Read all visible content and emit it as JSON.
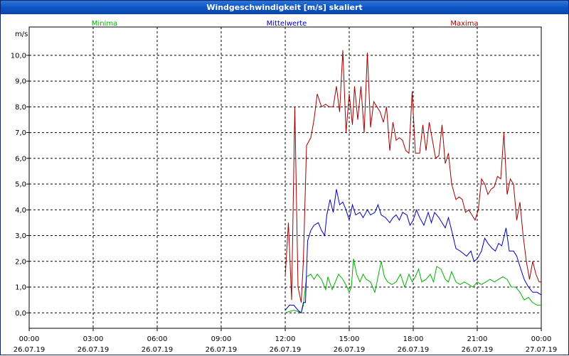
{
  "window": {
    "title": "Windgeschwindigkeit [m/s] skaliert"
  },
  "colors": {
    "minima": "#00b000",
    "mittelwerte": "#0000c0",
    "maxima": "#a00000",
    "grid": "#000000"
  },
  "chart_data": {
    "type": "line",
    "title": "Windgeschwindigkeit [m/s] skaliert",
    "ylabel": "m/s",
    "ylim": [
      -0.6,
      11.1
    ],
    "y_ticks": [
      "0,0",
      "1,0",
      "2,0",
      "3,0",
      "4,0",
      "5,0",
      "6,0",
      "7,0",
      "8,0",
      "9,0",
      "10,0"
    ],
    "xlim": [
      0,
      24
    ],
    "x_ticks": [
      {
        "time": "00:00",
        "date": "26.07.19"
      },
      {
        "time": "03:00",
        "date": "26.07.19"
      },
      {
        "time": "06:00",
        "date": "26.07.19"
      },
      {
        "time": "09:00",
        "date": "26.07.19"
      },
      {
        "time": "12:00",
        "date": "26.07.19"
      },
      {
        "time": "15:00",
        "date": "26.07.19"
      },
      {
        "time": "18:00",
        "date": "26.07.19"
      },
      {
        "time": "21:00",
        "date": "26.07.19"
      },
      {
        "time": "00:00",
        "date": "27.07.19"
      }
    ],
    "grid": true,
    "legend_position": "top",
    "series": [
      {
        "name": "Minima",
        "color": "#00b000",
        "points": [
          [
            12.0,
            0.0
          ],
          [
            12.2,
            0.05
          ],
          [
            12.4,
            0.1
          ],
          [
            12.6,
            0.05
          ],
          [
            12.75,
            0.0
          ],
          [
            12.85,
            0.3
          ],
          [
            13.0,
            1.4
          ],
          [
            13.2,
            1.5
          ],
          [
            13.35,
            1.3
          ],
          [
            13.5,
            1.5
          ],
          [
            13.7,
            1.3
          ],
          [
            13.9,
            0.9
          ],
          [
            14.0,
            1.4
          ],
          [
            14.2,
            0.9
          ],
          [
            14.4,
            1.3
          ],
          [
            14.5,
            1.5
          ],
          [
            14.7,
            1.3
          ],
          [
            14.9,
            1.0
          ],
          [
            15.0,
            0.8
          ],
          [
            15.1,
            1.0
          ],
          [
            15.2,
            2.1
          ],
          [
            15.35,
            1.5
          ],
          [
            15.5,
            1.2
          ],
          [
            15.65,
            1.5
          ],
          [
            15.8,
            1.3
          ],
          [
            16.0,
            1.2
          ],
          [
            16.2,
            0.8
          ],
          [
            16.35,
            1.4
          ],
          [
            16.5,
            2.0
          ],
          [
            16.65,
            1.4
          ],
          [
            16.8,
            1.2
          ],
          [
            17.0,
            1.1
          ],
          [
            17.2,
            1.2
          ],
          [
            17.4,
            1.5
          ],
          [
            17.6,
            1.0
          ],
          [
            17.8,
            1.5
          ],
          [
            17.95,
            1.2
          ],
          [
            18.1,
            1.4
          ],
          [
            18.25,
            1.7
          ],
          [
            18.4,
            1.2
          ],
          [
            18.6,
            1.3
          ],
          [
            18.8,
            1.5
          ],
          [
            18.95,
            1.2
          ],
          [
            19.1,
            1.8
          ],
          [
            19.3,
            1.7
          ],
          [
            19.5,
            1.3
          ],
          [
            19.65,
            1.2
          ],
          [
            19.8,
            1.6
          ],
          [
            20.0,
            1.2
          ],
          [
            20.2,
            1.1
          ],
          [
            20.4,
            1.2
          ],
          [
            20.6,
            1.1
          ],
          [
            20.8,
            1.0
          ],
          [
            21.0,
            1.2
          ],
          [
            21.2,
            1.1
          ],
          [
            21.4,
            1.2
          ],
          [
            21.6,
            1.3
          ],
          [
            21.8,
            1.2
          ],
          [
            22.0,
            1.3
          ],
          [
            22.2,
            1.4
          ],
          [
            22.4,
            1.3
          ],
          [
            22.6,
            1.0
          ],
          [
            22.8,
            1.0
          ],
          [
            23.0,
            0.8
          ],
          [
            23.2,
            0.5
          ],
          [
            23.4,
            0.6
          ],
          [
            23.6,
            0.4
          ],
          [
            23.8,
            0.3
          ],
          [
            24.0,
            0.3
          ]
        ]
      },
      {
        "name": "Mittelwerte",
        "color": "#0000c0",
        "points": [
          [
            12.0,
            0.1
          ],
          [
            12.2,
            0.3
          ],
          [
            12.4,
            0.3
          ],
          [
            12.6,
            0.1
          ],
          [
            12.75,
            0.0
          ],
          [
            12.85,
            0.4
          ],
          [
            12.95,
            0.4
          ],
          [
            13.05,
            2.8
          ],
          [
            13.2,
            3.2
          ],
          [
            13.35,
            3.4
          ],
          [
            13.55,
            3.5
          ],
          [
            13.7,
            3.2
          ],
          [
            13.85,
            3.0
          ],
          [
            13.95,
            3.8
          ],
          [
            14.1,
            4.4
          ],
          [
            14.25,
            3.9
          ],
          [
            14.4,
            4.8
          ],
          [
            14.55,
            4.2
          ],
          [
            14.7,
            4.3
          ],
          [
            14.85,
            4.0
          ],
          [
            15.0,
            3.6
          ],
          [
            15.15,
            4.2
          ],
          [
            15.3,
            3.8
          ],
          [
            15.5,
            3.9
          ],
          [
            15.65,
            3.7
          ],
          [
            15.85,
            4.0
          ],
          [
            16.0,
            3.8
          ],
          [
            16.2,
            3.9
          ],
          [
            16.35,
            4.2
          ],
          [
            16.5,
            3.8
          ],
          [
            16.7,
            3.7
          ],
          [
            16.9,
            3.5
          ],
          [
            17.05,
            3.7
          ],
          [
            17.2,
            3.8
          ],
          [
            17.35,
            3.6
          ],
          [
            17.5,
            3.9
          ],
          [
            17.7,
            3.8
          ],
          [
            17.85,
            3.4
          ],
          [
            18.0,
            3.6
          ],
          [
            18.15,
            4.0
          ],
          [
            18.3,
            3.7
          ],
          [
            18.5,
            3.4
          ],
          [
            18.7,
            3.9
          ],
          [
            18.85,
            3.5
          ],
          [
            19.0,
            3.9
          ],
          [
            19.2,
            3.7
          ],
          [
            19.35,
            3.5
          ],
          [
            19.5,
            3.3
          ],
          [
            19.65,
            3.7
          ],
          [
            19.8,
            3.2
          ],
          [
            20.0,
            2.5
          ],
          [
            20.2,
            2.4
          ],
          [
            20.35,
            2.3
          ],
          [
            20.5,
            2.2
          ],
          [
            20.7,
            2.4
          ],
          [
            20.85,
            2.0
          ],
          [
            21.0,
            2.1
          ],
          [
            21.2,
            2.4
          ],
          [
            21.35,
            2.9
          ],
          [
            21.5,
            2.7
          ],
          [
            21.7,
            2.5
          ],
          [
            21.85,
            2.4
          ],
          [
            22.0,
            2.7
          ],
          [
            22.15,
            2.6
          ],
          [
            22.35,
            3.3
          ],
          [
            22.5,
            2.4
          ],
          [
            22.7,
            2.4
          ],
          [
            22.85,
            2.2
          ],
          [
            23.0,
            1.8
          ],
          [
            23.2,
            1.3
          ],
          [
            23.4,
            1.0
          ],
          [
            23.6,
            0.8
          ],
          [
            23.8,
            0.8
          ],
          [
            24.0,
            0.7
          ]
        ]
      },
      {
        "name": "Maxima",
        "color": "#a00000",
        "points": [
          [
            12.0,
            1.4
          ],
          [
            12.15,
            3.5
          ],
          [
            12.3,
            0.5
          ],
          [
            12.45,
            8.0
          ],
          [
            12.6,
            1.0
          ],
          [
            12.75,
            0.4
          ],
          [
            12.85,
            2.0
          ],
          [
            13.0,
            6.5
          ],
          [
            13.2,
            6.8
          ],
          [
            13.35,
            7.5
          ],
          [
            13.5,
            8.5
          ],
          [
            13.7,
            8.0
          ],
          [
            13.9,
            8.1
          ],
          [
            14.05,
            8.0
          ],
          [
            14.25,
            8.0
          ],
          [
            14.4,
            8.8
          ],
          [
            14.55,
            7.8
          ],
          [
            14.7,
            10.2
          ],
          [
            14.85,
            7.0
          ],
          [
            15.0,
            8.5
          ],
          [
            15.15,
            7.3
          ],
          [
            15.25,
            8.8
          ],
          [
            15.4,
            7.5
          ],
          [
            15.55,
            8.8
          ],
          [
            15.7,
            7.0
          ],
          [
            15.85,
            10.1
          ],
          [
            16.0,
            7.2
          ],
          [
            16.15,
            8.2
          ],
          [
            16.3,
            8.0
          ],
          [
            16.45,
            7.8
          ],
          [
            16.6,
            7.4
          ],
          [
            16.75,
            8.0
          ],
          [
            16.9,
            6.3
          ],
          [
            17.05,
            7.4
          ],
          [
            17.2,
            6.7
          ],
          [
            17.35,
            6.8
          ],
          [
            17.5,
            6.7
          ],
          [
            17.65,
            6.3
          ],
          [
            17.8,
            6.2
          ],
          [
            17.95,
            8.6
          ],
          [
            18.1,
            6.2
          ],
          [
            18.3,
            6.2
          ],
          [
            18.45,
            7.3
          ],
          [
            18.6,
            6.3
          ],
          [
            18.75,
            7.4
          ],
          [
            18.9,
            6.7
          ],
          [
            19.05,
            6.0
          ],
          [
            19.2,
            6.1
          ],
          [
            19.35,
            7.3
          ],
          [
            19.5,
            5.8
          ],
          [
            19.65,
            6.2
          ],
          [
            19.8,
            5.0
          ],
          [
            20.0,
            4.4
          ],
          [
            20.15,
            4.5
          ],
          [
            20.3,
            4.4
          ],
          [
            20.45,
            3.9
          ],
          [
            20.6,
            4.0
          ],
          [
            20.75,
            3.8
          ],
          [
            20.9,
            3.6
          ],
          [
            21.05,
            4.0
          ],
          [
            21.2,
            5.2
          ],
          [
            21.35,
            5.0
          ],
          [
            21.5,
            4.6
          ],
          [
            21.65,
            4.8
          ],
          [
            21.8,
            4.9
          ],
          [
            21.95,
            5.3
          ],
          [
            22.1,
            5.2
          ],
          [
            22.25,
            7.0
          ],
          [
            22.4,
            4.6
          ],
          [
            22.55,
            5.2
          ],
          [
            22.7,
            5.0
          ],
          [
            22.85,
            3.6
          ],
          [
            23.0,
            4.3
          ],
          [
            23.15,
            3.0
          ],
          [
            23.3,
            2.0
          ],
          [
            23.45,
            1.3
          ],
          [
            23.6,
            2.0
          ],
          [
            23.75,
            1.5
          ],
          [
            23.9,
            1.2
          ],
          [
            24.0,
            1.2
          ]
        ]
      }
    ]
  }
}
